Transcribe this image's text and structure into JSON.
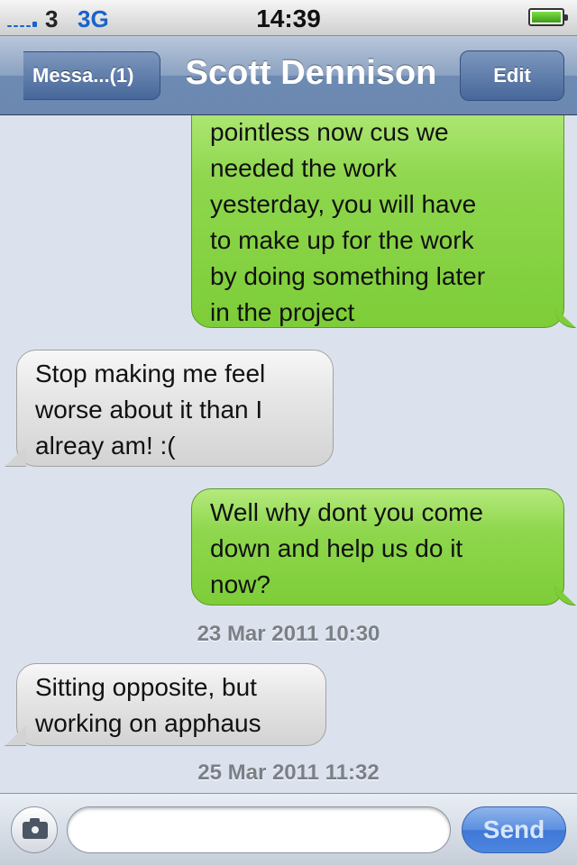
{
  "status_bar": {
    "carrier": "3",
    "network": "3G",
    "time": "14:39",
    "battery_level": 1.0,
    "colors": {
      "network": "#1a63c9"
    }
  },
  "nav_bar": {
    "back_label": "Messa...(1)",
    "title": "Scott Dennison",
    "edit_label": "Edit"
  },
  "messages": [
    {
      "direction": "sent",
      "text": "pointless now cus we\nneeded the work\nyesterday, you will have\nto make up for the work\nby doing something later\nin the project"
    },
    {
      "direction": "received",
      "text": "Stop making me feel\nworse about it than I\nalreay am! :("
    },
    {
      "direction": "sent",
      "text": "Well why dont you come\ndown and help us do it\nnow?"
    },
    {
      "type": "timestamp",
      "text": "23 Mar 2011 10:30"
    },
    {
      "direction": "received",
      "text": "Sitting opposite, but\nworking on apphaus"
    },
    {
      "type": "timestamp",
      "text": "25 Mar 2011 11:32"
    }
  ],
  "composer": {
    "input_value": "",
    "input_placeholder": "",
    "send_label": "Send",
    "camera_icon": "camera-icon"
  },
  "colors": {
    "sent_bubble": "#8fd74e",
    "received_bubble": "#e6e6e6",
    "background": "#dbe2ed",
    "nav_bar": "#6d8ab2",
    "send_button": "#4c86e0"
  }
}
